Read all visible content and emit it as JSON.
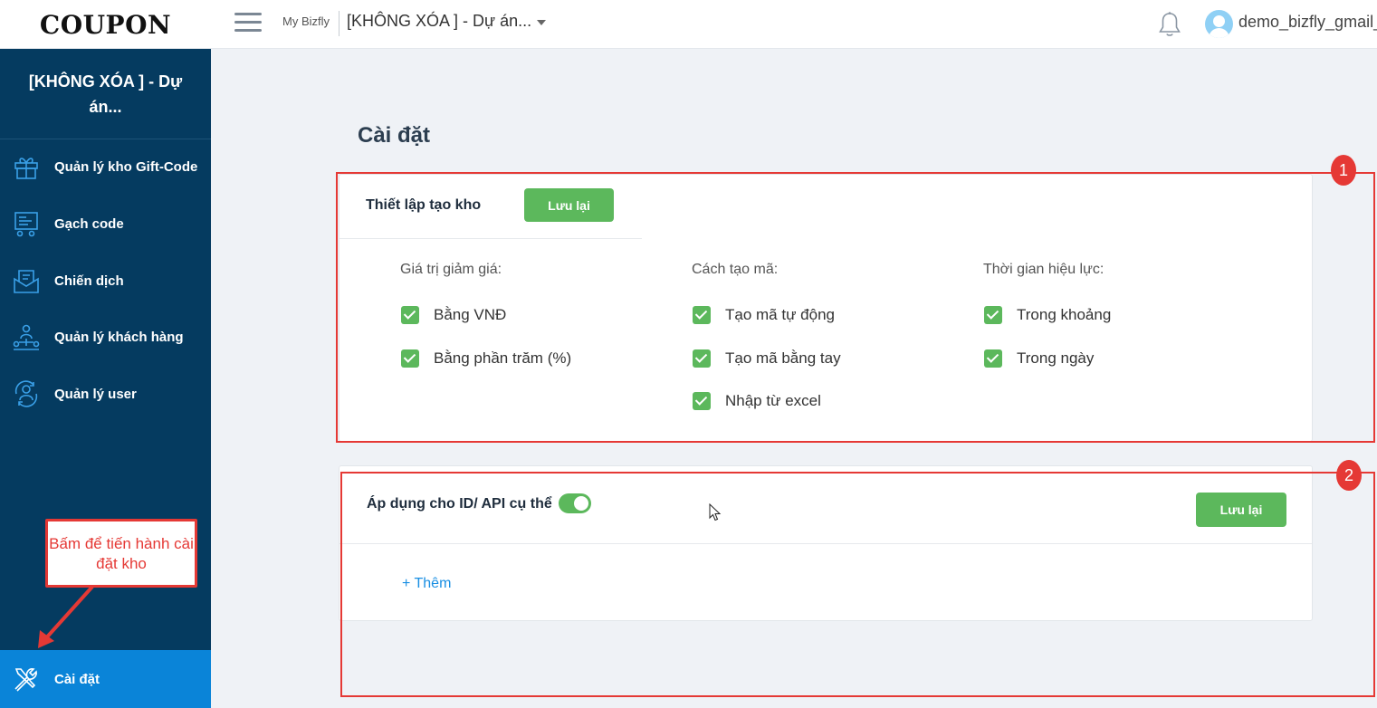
{
  "app": {
    "logo": "COUPON",
    "brand": "My Bizfly",
    "project": "[KHÔNG XÓA ] - Dự án...",
    "user": "demo_bizfly_gmail_"
  },
  "sidebar": {
    "project_title": "[KHÔNG XÓA ] - Dự án...",
    "items": [
      {
        "label": "Quản lý kho Gift-Code",
        "icon": "gift-icon"
      },
      {
        "label": "Gạch code",
        "icon": "scan-code-icon"
      },
      {
        "label": "Chiến dịch",
        "icon": "campaign-icon"
      },
      {
        "label": "Quản lý khách hàng",
        "icon": "customers-icon"
      },
      {
        "label": "Quản lý user",
        "icon": "users-icon"
      }
    ],
    "active_item": {
      "label": "Cài đặt",
      "icon": "settings-tools-icon"
    }
  },
  "main": {
    "title": "Cài đặt",
    "card1": {
      "title": "Thiết lập tạo kho",
      "save_label": "Lưu lại",
      "columns": [
        {
          "title": "Giá trị giảm giá:",
          "options": [
            {
              "label": "Bằng VNĐ",
              "checked": true
            },
            {
              "label": "Bằng phần trăm (%)",
              "checked": true
            }
          ]
        },
        {
          "title": "Cách tạo mã:",
          "options": [
            {
              "label": "Tạo mã tự động",
              "checked": true
            },
            {
              "label": "Tạo mã bằng tay",
              "checked": true
            },
            {
              "label": "Nhập từ excel",
              "checked": true
            }
          ]
        },
        {
          "title": "Thời gian hiệu lực:",
          "options": [
            {
              "label": "Trong khoảng",
              "checked": true
            },
            {
              "label": "Trong ngày",
              "checked": true
            }
          ]
        }
      ]
    },
    "card2": {
      "title": "Áp dụng cho ID/ API cụ thể",
      "toggle_on": true,
      "save_label": "Lưu lại",
      "add_label": "+ Thêm"
    }
  },
  "annotations": {
    "badge1": "1",
    "badge2": "2",
    "callout": "Bấm để tiến hành cài đặt kho"
  },
  "colors": {
    "sidebar": "#053b60",
    "active": "#0a84d8",
    "accent_green": "#5cb85c",
    "annotation_red": "#e53935",
    "link": "#1a8fe3"
  }
}
